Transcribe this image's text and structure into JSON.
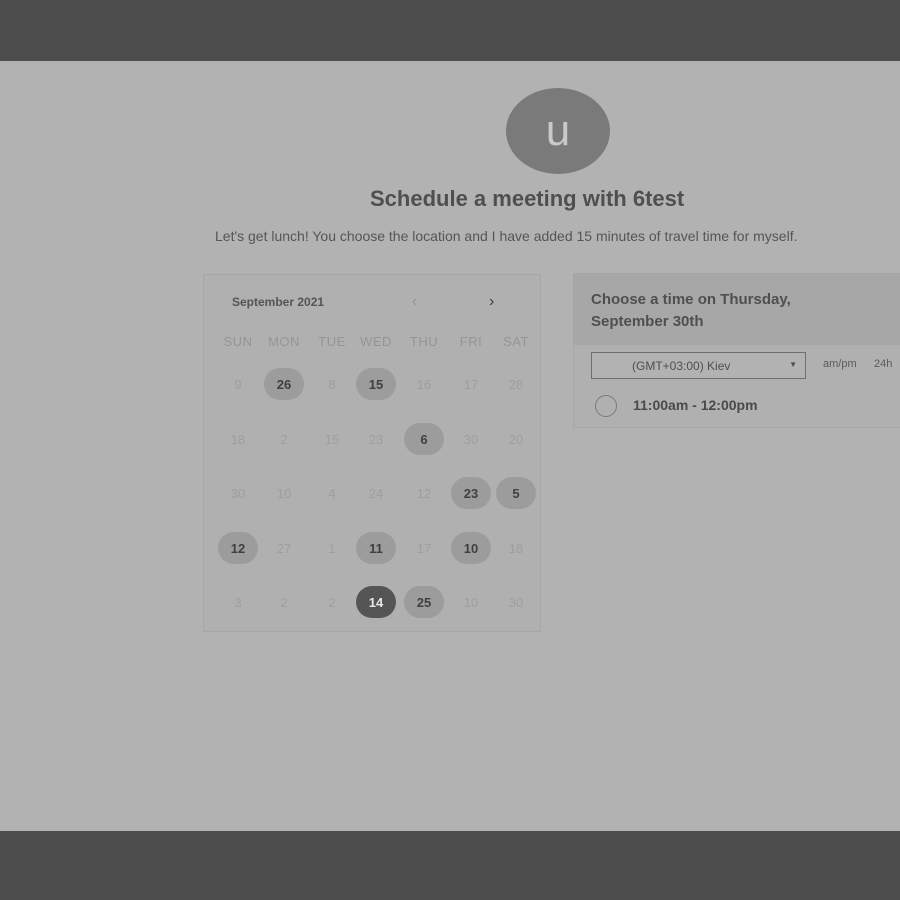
{
  "profile": {
    "avatar_letter": "u"
  },
  "header": {
    "title": "Schedule a meeting with 6test",
    "subtitle": "Let's get lunch! You choose the location and I have added 15 minutes of travel time for myself."
  },
  "calendar": {
    "month_label": "September 2021",
    "prev_icon": "‹",
    "next_icon": "›",
    "weekdays": [
      "SUN",
      "MON",
      "TUE",
      "WED",
      "THU",
      "FRI",
      "SAT"
    ],
    "weeks": [
      [
        {
          "d": "9"
        },
        {
          "d": "26",
          "s": "available"
        },
        {
          "d": "8"
        },
        {
          "d": "15",
          "s": "available"
        },
        {
          "d": "16"
        },
        {
          "d": "17"
        },
        {
          "d": "28"
        }
      ],
      [
        {
          "d": "18"
        },
        {
          "d": "2"
        },
        {
          "d": "15"
        },
        {
          "d": "23"
        },
        {
          "d": "6",
          "s": "available"
        },
        {
          "d": "30"
        },
        {
          "d": "20"
        }
      ],
      [
        {
          "d": "30"
        },
        {
          "d": "10"
        },
        {
          "d": "4"
        },
        {
          "d": "24"
        },
        {
          "d": "12"
        },
        {
          "d": "23",
          "s": "available"
        },
        {
          "d": "5",
          "s": "available"
        }
      ],
      [
        {
          "d": "12",
          "s": "available"
        },
        {
          "d": "27"
        },
        {
          "d": "1"
        },
        {
          "d": "11",
          "s": "available"
        },
        {
          "d": "17"
        },
        {
          "d": "10",
          "s": "available"
        },
        {
          "d": "18"
        }
      ],
      [
        {
          "d": "3"
        },
        {
          "d": "2"
        },
        {
          "d": "2"
        },
        {
          "d": "14",
          "s": "selected"
        },
        {
          "d": "25",
          "s": "available"
        },
        {
          "d": "10"
        },
        {
          "d": "30"
        }
      ]
    ]
  },
  "time_panel": {
    "title": "Choose a time on Thursday, September 30th",
    "timezone": "(GMT+03:00) Kiev",
    "format_ampm": "am/pm",
    "format_24h": "24h",
    "slots": [
      "11:00am - 12:00pm"
    ]
  },
  "colors": {
    "available": "#9c9c9c",
    "selected": "#555555",
    "background": "#b2b2b2",
    "frame": "#4d4d4d"
  }
}
